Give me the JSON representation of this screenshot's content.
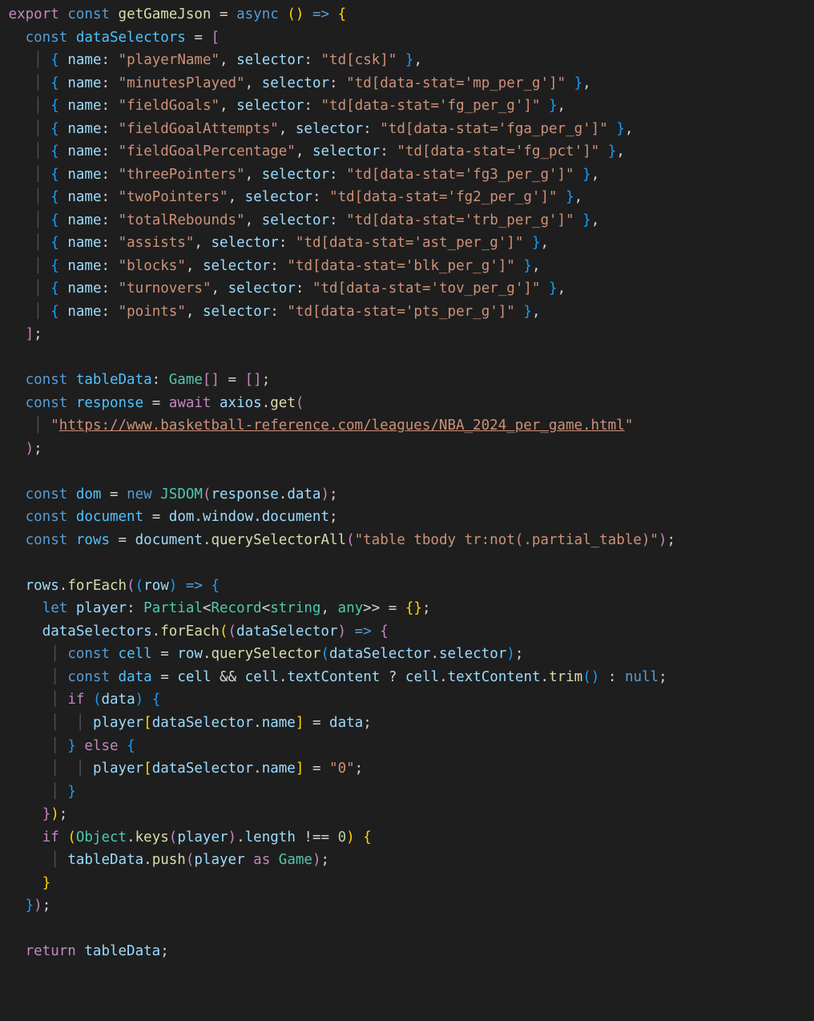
{
  "code": {
    "fnName": "getGameJson",
    "selectors": [
      {
        "name": "playerName",
        "sel": "td[csk]"
      },
      {
        "name": "minutesPlayed",
        "sel": "td[data-stat='mp_per_g']"
      },
      {
        "name": "fieldGoals",
        "sel": "td[data-stat='fg_per_g']"
      },
      {
        "name": "fieldGoalAttempts",
        "sel": "td[data-stat='fga_per_g']"
      },
      {
        "name": "fieldGoalPercentage",
        "sel": "td[data-stat='fg_pct']"
      },
      {
        "name": "threePointers",
        "sel": "td[data-stat='fg3_per_g']"
      },
      {
        "name": "twoPointers",
        "sel": "td[data-stat='fg2_per_g']"
      },
      {
        "name": "totalRebounds",
        "sel": "td[data-stat='trb_per_g']"
      },
      {
        "name": "assists",
        "sel": "td[data-stat='ast_per_g']"
      },
      {
        "name": "blocks",
        "sel": "td[data-stat='blk_per_g']"
      },
      {
        "name": "turnovers",
        "sel": "td[data-stat='tov_per_g']"
      },
      {
        "name": "points",
        "sel": "td[data-stat='pts_per_g']"
      }
    ],
    "url": "https://www.basketball-reference.com/leagues/NBA_2024_per_game.html",
    "rowsQuery": "table tbody tr:not(.partial_table)",
    "defaultVal": "0",
    "strings": {
      "export": "export",
      "const": "const",
      "async": "async",
      "await": "await",
      "new": "new",
      "let": "let",
      "if": "if",
      "else": "else",
      "return": "return",
      "as": "as",
      "dataSelectors": "dataSelectors",
      "tableData": "tableData",
      "Game": "Game",
      "response": "response",
      "axios": "axios",
      "get": "get",
      "dom": "dom",
      "JSDOM": "JSDOM",
      "document": "document",
      "window": "window",
      "rows": "rows",
      "querySelectorAll": "querySelectorAll",
      "forEach": "forEach",
      "row": "row",
      "player": "player",
      "Partial": "Partial",
      "Record": "Record",
      "string": "string",
      "any": "any",
      "dataSelector": "dataSelector",
      "cell": "cell",
      "querySelector": "querySelector",
      "selector": "selector",
      "data": "data",
      "textContent": "textContent",
      "trim": "trim",
      "null": "null",
      "Object": "Object",
      "keys": "keys",
      "length": "length",
      "push": "push",
      "name": "name"
    }
  }
}
